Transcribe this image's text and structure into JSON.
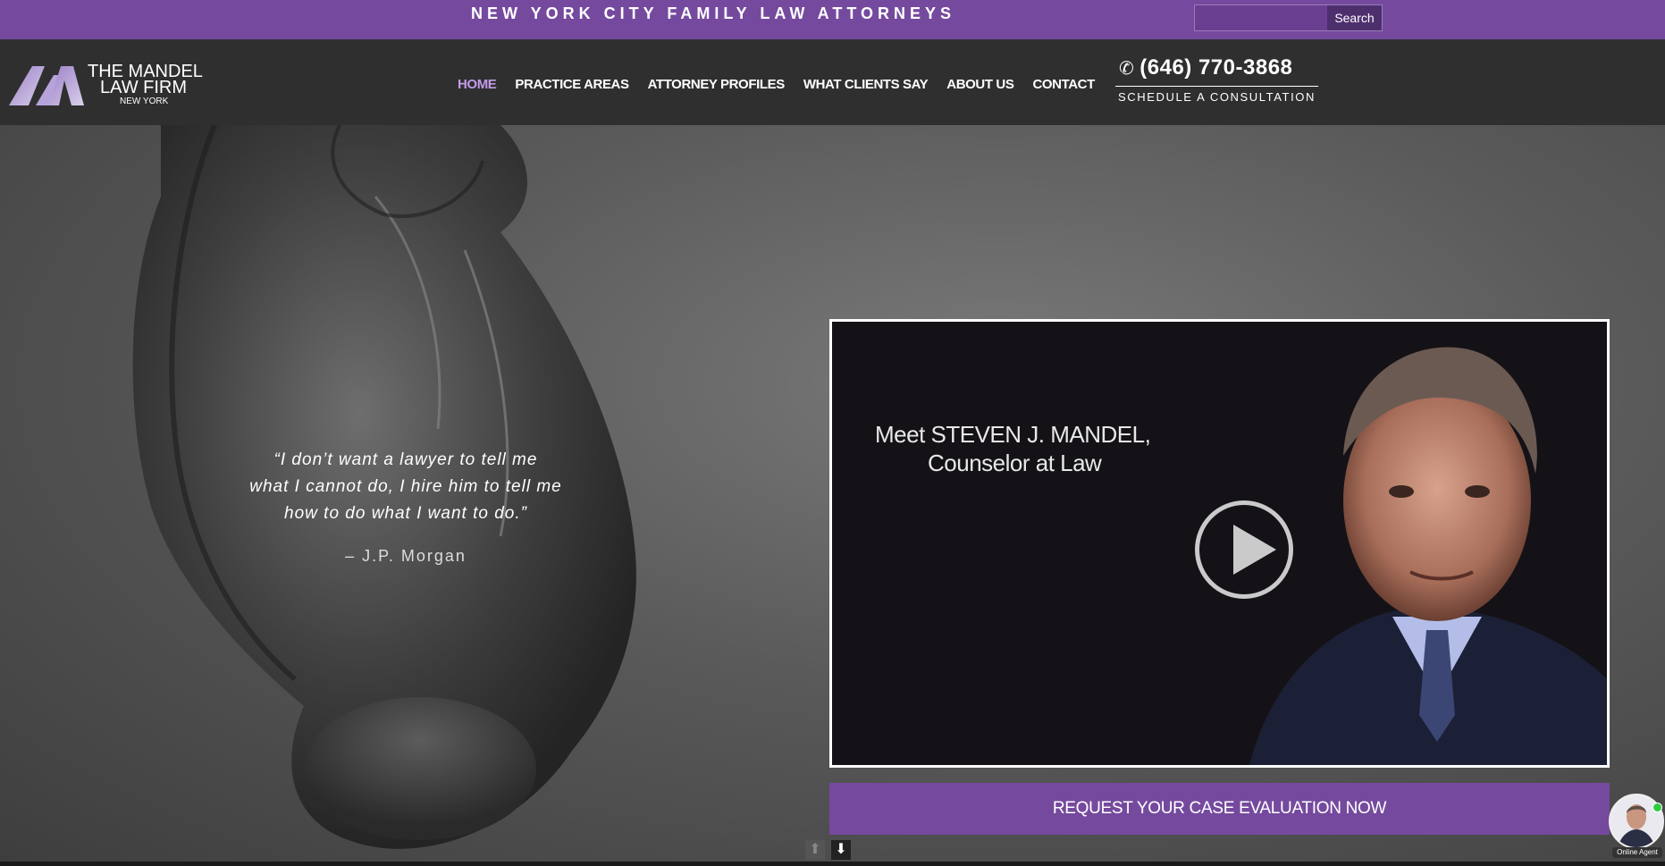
{
  "topbar": {
    "tagline": "NEW YORK CITY FAMILY LAW ATTORNEYS",
    "search_placeholder": "",
    "search_button": "Search"
  },
  "logo": {
    "line1": "THE MANDEL",
    "line2": "LAW FIRM",
    "line3": "NEW YORK"
  },
  "nav": {
    "items": [
      {
        "label": "HOME",
        "active": true
      },
      {
        "label": "PRACTICE AREAS"
      },
      {
        "label": "ATTORNEY PROFILES"
      },
      {
        "label": "WHAT CLIENTS SAY"
      },
      {
        "label": "ABOUT US"
      },
      {
        "label": "CONTACT"
      }
    ]
  },
  "contact": {
    "phone": "(646) 770-3868",
    "schedule": "SCHEDULE A CONSULTATION"
  },
  "hero": {
    "quote_line1": "“I don’t want a lawyer to tell me",
    "quote_line2": "what I cannot do, I hire him to tell me",
    "quote_line3": "how to do what I want to do.”",
    "author": "– J.P. Morgan"
  },
  "video": {
    "title_line1": "Meet  STEVEN J. MANDEL,",
    "title_line2": "Counselor at Law"
  },
  "cta": {
    "label": "REQUEST YOUR CASE EVALUATION NOW"
  },
  "chat": {
    "label": "Online Agent"
  },
  "colors": {
    "brand_purple": "#754a9e",
    "active_nav": "#c29be8",
    "header_bg": "#2f2f2f"
  }
}
